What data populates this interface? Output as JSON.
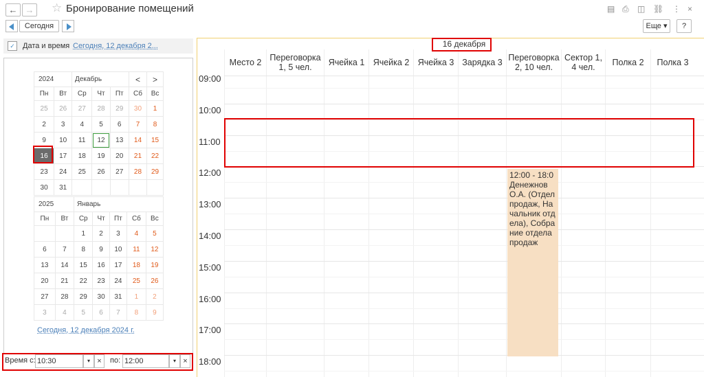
{
  "window": {
    "title": "Бронирование помещений"
  },
  "toolbar": {
    "today_label": "Сегодня",
    "more_label": "Еще",
    "help_label": "?"
  },
  "filter": {
    "label": "Дата и время",
    "value": "Сегодня, 12 декабря 2..."
  },
  "calendar": {
    "weekdays": [
      "Пн",
      "Вт",
      "Ср",
      "Чт",
      "Пт",
      "Сб",
      "Вс"
    ],
    "month1": {
      "year": "2024",
      "month": "Декабрь",
      "prev": "<",
      "next": ">",
      "weeks": [
        [
          "25",
          "26",
          "27",
          "28",
          "29",
          "30",
          "1"
        ],
        [
          "2",
          "3",
          "4",
          "5",
          "6",
          "7",
          "8"
        ],
        [
          "9",
          "10",
          "11",
          "12",
          "13",
          "14",
          "15"
        ],
        [
          "16",
          "17",
          "18",
          "19",
          "20",
          "21",
          "22"
        ],
        [
          "23",
          "24",
          "25",
          "26",
          "27",
          "28",
          "29"
        ],
        [
          "30",
          "31",
          "",
          "",
          "",
          "",
          ""
        ]
      ]
    },
    "month2": {
      "year": "2025",
      "month": "Январь",
      "weeks": [
        [
          "",
          "",
          "1",
          "2",
          "3",
          "4",
          "5"
        ],
        [
          "6",
          "7",
          "8",
          "9",
          "10",
          "11",
          "12"
        ],
        [
          "13",
          "14",
          "15",
          "16",
          "17",
          "18",
          "19"
        ],
        [
          "20",
          "21",
          "22",
          "23",
          "24",
          "25",
          "26"
        ],
        [
          "27",
          "28",
          "29",
          "30",
          "31",
          "1",
          "2"
        ],
        [
          "3",
          "4",
          "5",
          "6",
          "7",
          "8",
          "9"
        ]
      ]
    },
    "today_link": "Сегодня, 12 декабря 2024 г."
  },
  "time_filter": {
    "from_label": "Время с:",
    "from_value": "10:30",
    "to_label": "по:",
    "to_value": "12:00"
  },
  "schedule": {
    "date": "16 декабря",
    "columns": [
      "Место 2",
      "Переговорка 1, 5 чел.",
      "Ячейка 1",
      "Ячейка 2",
      "Ячейка 3",
      "Зарядка 3",
      "Переговорка 2, 10 чел.",
      "Сектор 1, 4 чел.",
      "Полка 2",
      "Полка 3"
    ],
    "times": [
      "09:00",
      "10:00",
      "11:00",
      "12:00",
      "13:00",
      "14:00",
      "15:00",
      "16:00",
      "17:00",
      "18:00"
    ],
    "event": {
      "time": "12:00 - 18:0",
      "text": "Денежнов О.А. (Отдел продаж, Начальник отдела), Собрание отдела продаж"
    }
  }
}
